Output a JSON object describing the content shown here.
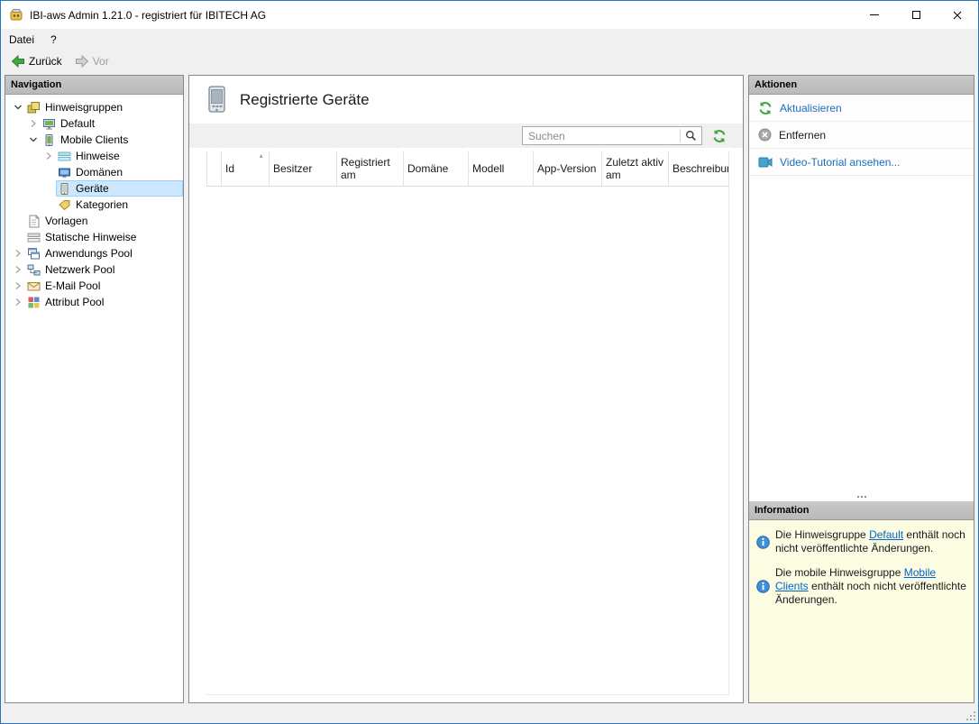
{
  "window": {
    "title": "IBI-aws Admin 1.21.0 - registriert für IBITECH AG",
    "accent_color": "#2675bf"
  },
  "menubar": {
    "items": [
      {
        "id": "datei",
        "label": "Datei"
      },
      {
        "id": "hilfe",
        "label": "?"
      }
    ]
  },
  "toolbar": {
    "back": "Zurück",
    "forward": "Vor"
  },
  "navigation": {
    "header": "Navigation",
    "tree": [
      {
        "id": "hinweisgruppen",
        "label": "Hinweisgruppen",
        "level": 0,
        "chevron": "expanded",
        "icon": "group-icon"
      },
      {
        "id": "default",
        "label": "Default",
        "level": 1,
        "chevron": "collapsed",
        "icon": "client-icon"
      },
      {
        "id": "mobile-clients",
        "label": "Mobile Clients",
        "level": 1,
        "chevron": "expanded",
        "icon": "mobile-group-icon"
      },
      {
        "id": "hinweise",
        "label": "Hinweise",
        "level": 2,
        "chevron": "collapsed",
        "icon": "hint-icon"
      },
      {
        "id": "domaenen",
        "label": "Domänen",
        "level": 2,
        "chevron": "none",
        "icon": "domain-icon"
      },
      {
        "id": "geraete",
        "label": "Geräte",
        "level": 2,
        "chevron": "none",
        "icon": "device-icon",
        "selected": true
      },
      {
        "id": "kategorien",
        "label": "Kategorien",
        "level": 2,
        "chevron": "none",
        "icon": "categories-icon"
      },
      {
        "id": "vorlagen",
        "label": "Vorlagen",
        "level": 0,
        "chevron": "none",
        "icon": "template-icon"
      },
      {
        "id": "statische-hinweise",
        "label": "Statische Hinweise",
        "level": 0,
        "chevron": "none",
        "icon": "static-hint-icon"
      },
      {
        "id": "anwendungs-pool",
        "label": "Anwendungs Pool",
        "level": 0,
        "chevron": "collapsed",
        "icon": "app-pool-icon"
      },
      {
        "id": "netzwerk-pool",
        "label": "Netzwerk Pool",
        "level": 0,
        "chevron": "collapsed",
        "icon": "network-pool-icon"
      },
      {
        "id": "email-pool",
        "label": "E-Mail Pool",
        "level": 0,
        "chevron": "collapsed",
        "icon": "email-pool-icon"
      },
      {
        "id": "attribut-pool",
        "label": "Attribut Pool",
        "level": 0,
        "chevron": "collapsed",
        "icon": "attribut-pool-icon"
      }
    ]
  },
  "main": {
    "title": "Registrierte Geräte",
    "search": {
      "placeholder": "Suchen"
    },
    "table": {
      "columns": [
        {
          "id": "spacer",
          "label": ""
        },
        {
          "id": "id",
          "label": "Id",
          "sorted": "asc"
        },
        {
          "id": "besitzer",
          "label": "Besitzer"
        },
        {
          "id": "registriert-am",
          "label": "Registriert am"
        },
        {
          "id": "domaene",
          "label": "Domäne"
        },
        {
          "id": "modell",
          "label": "Modell"
        },
        {
          "id": "app-version",
          "label": "App-Version"
        },
        {
          "id": "zuletzt-aktiv-am",
          "label": "Zuletzt aktiv am"
        },
        {
          "id": "beschreibung",
          "label": "Beschreibun"
        }
      ],
      "rows": []
    }
  },
  "actions": {
    "header": "Aktionen",
    "items": [
      {
        "id": "aktualisieren",
        "label": "Aktualisieren",
        "icon": "refresh-icon",
        "style": "link"
      },
      {
        "id": "entfernen",
        "label": "Entfernen",
        "icon": "remove-icon",
        "style": "disabled"
      },
      {
        "id": "video-tutorial",
        "label": "Video-Tutorial ansehen...",
        "icon": "video-icon",
        "style": "link"
      }
    ]
  },
  "information": {
    "header": "Information",
    "items": [
      {
        "before": "Die Hinweisgruppe ",
        "link": "Default",
        "after": " enthält noch nicht veröffentlichte Änderungen."
      },
      {
        "before": "Die mobile Hinweisgruppe ",
        "link": "Mobile Clients",
        "after": " enthält noch nicht veröffentlichte Änderungen."
      }
    ]
  }
}
